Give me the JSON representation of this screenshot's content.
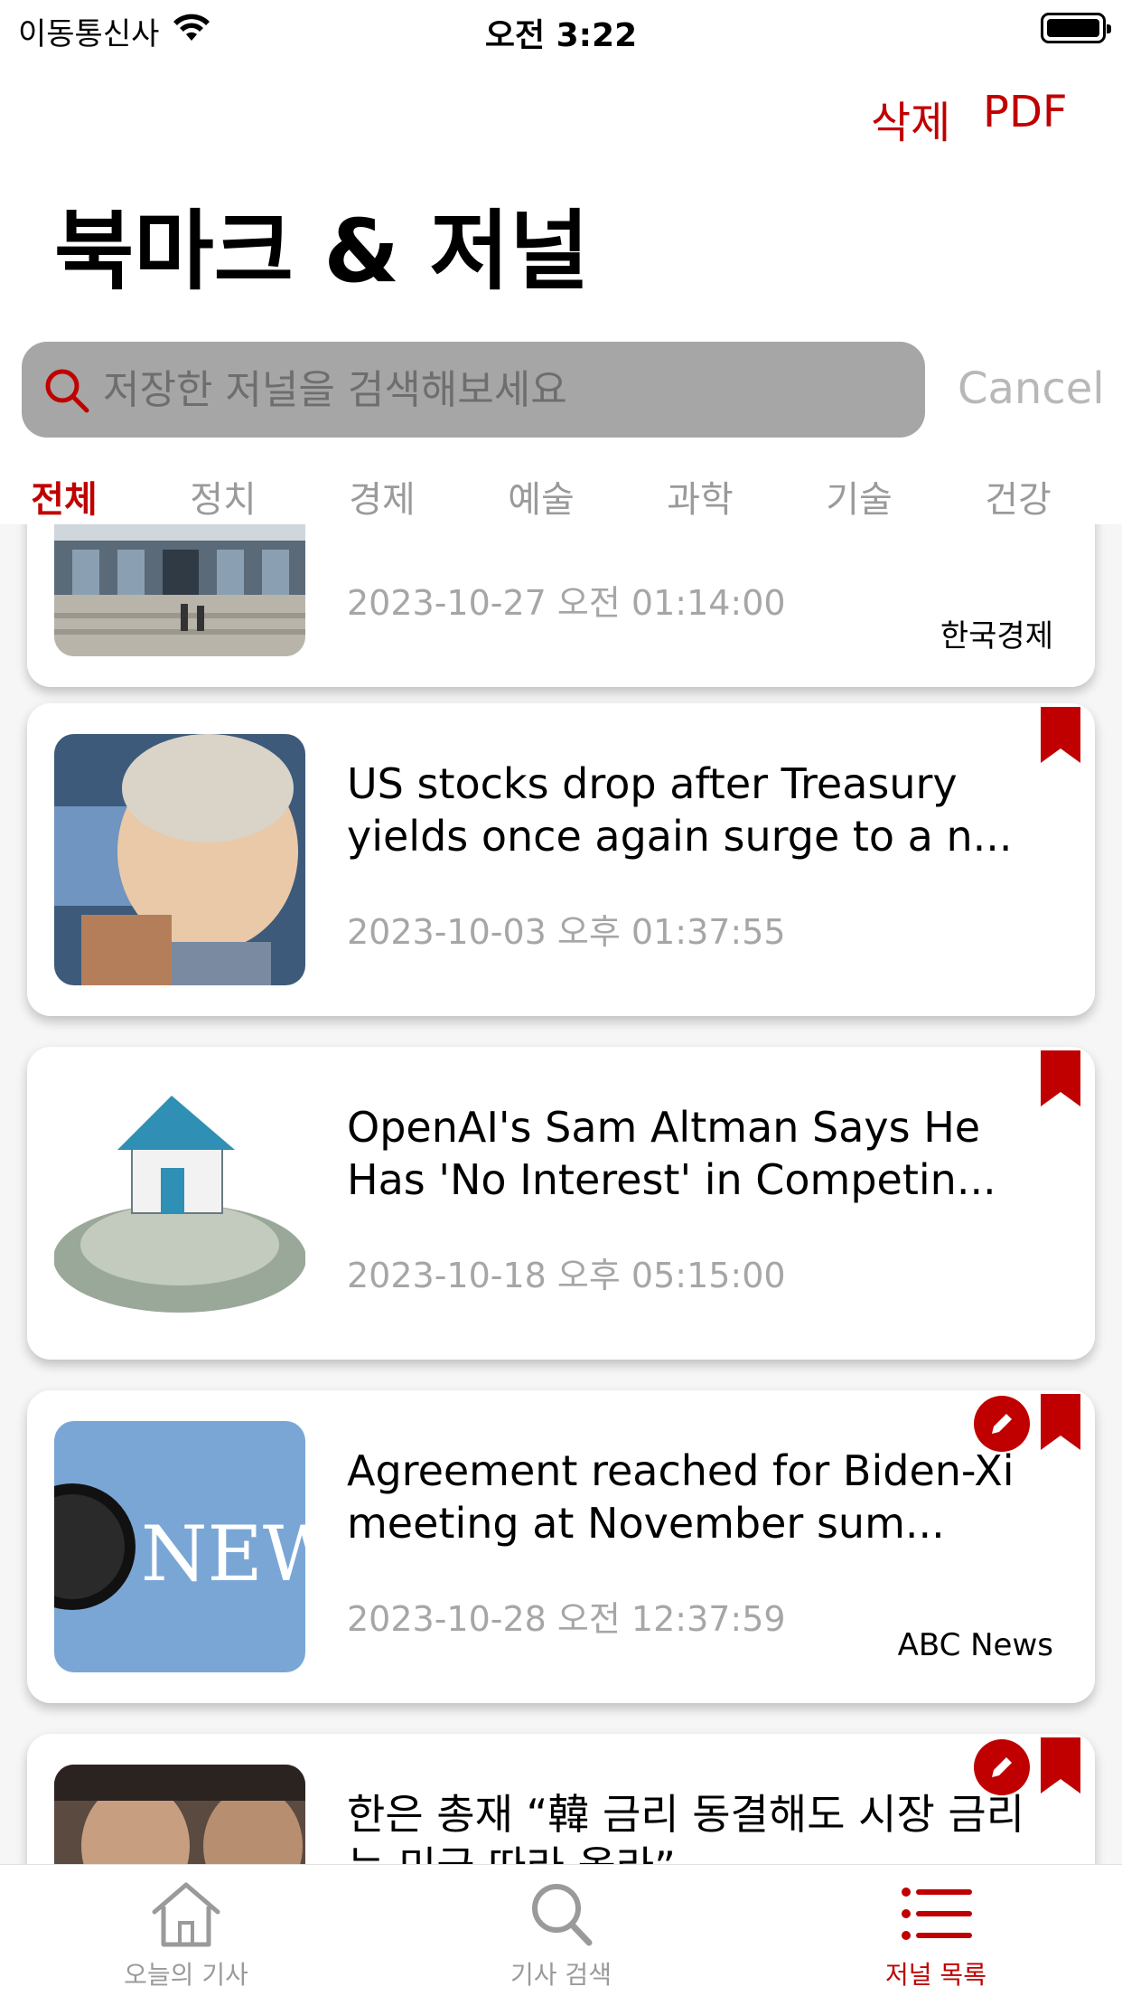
{
  "status_bar": {
    "carrier": "이동통신사",
    "time": "오전 3:22"
  },
  "nav": {
    "delete_label": "삭제",
    "pdf_label": "PDF",
    "title": "북마크 & 저널"
  },
  "search": {
    "placeholder": "저장한 저널을 검색해보세요",
    "value": "",
    "cancel_label": "Cancel"
  },
  "categories": [
    {
      "label": "전체",
      "active": true
    },
    {
      "label": "정치"
    },
    {
      "label": "경제"
    },
    {
      "label": "예술"
    },
    {
      "label": "과학"
    },
    {
      "label": "기술"
    },
    {
      "label": "건강"
    }
  ],
  "articles": [
    {
      "title": "",
      "date": "2023-10-27 오전 01:14:00",
      "source": "한국경제",
      "bookmarked": false,
      "has_journal": false,
      "thumbnail": "government-building"
    },
    {
      "title": "US stocks drop after Treasury yields once again surge to a n...",
      "date": "2023-10-03 오후 01:37:55",
      "source": "",
      "bookmarked": true,
      "has_journal": false,
      "thumbnail": "trader-facepalm"
    },
    {
      "title": "OpenAI's Sam Altman Says He Has 'No Interest' in Competin...",
      "date": "2023-10-18 오후 05:15:00",
      "source": "",
      "bookmarked": true,
      "has_journal": false,
      "thumbnail": "house-on-money"
    },
    {
      "title": "Agreement reached for Biden-Xi meeting at November sum...",
      "date": "2023-10-28 오전 12:37:59",
      "source": "ABC News",
      "bookmarked": true,
      "has_journal": true,
      "thumbnail": "abc-news-logo",
      "thumbnail_text": "NEW"
    },
    {
      "title": "한은 총재 “韓 금리 동결해도 시장 금리는 미국 따라 올라”",
      "date": "",
      "source": "",
      "bookmarked": true,
      "has_journal": true,
      "thumbnail": "people-photo"
    }
  ],
  "tabbar": [
    {
      "label": "오늘의 기사",
      "icon": "house-icon"
    },
    {
      "label": "기사 검색",
      "icon": "magnifier-icon"
    },
    {
      "label": "저널 목록",
      "icon": "list-icon",
      "active": true
    }
  ],
  "colors": {
    "accent": "#c00000",
    "search_bg": "#a6a6a6",
    "muted_text": "#a6a6a6"
  }
}
